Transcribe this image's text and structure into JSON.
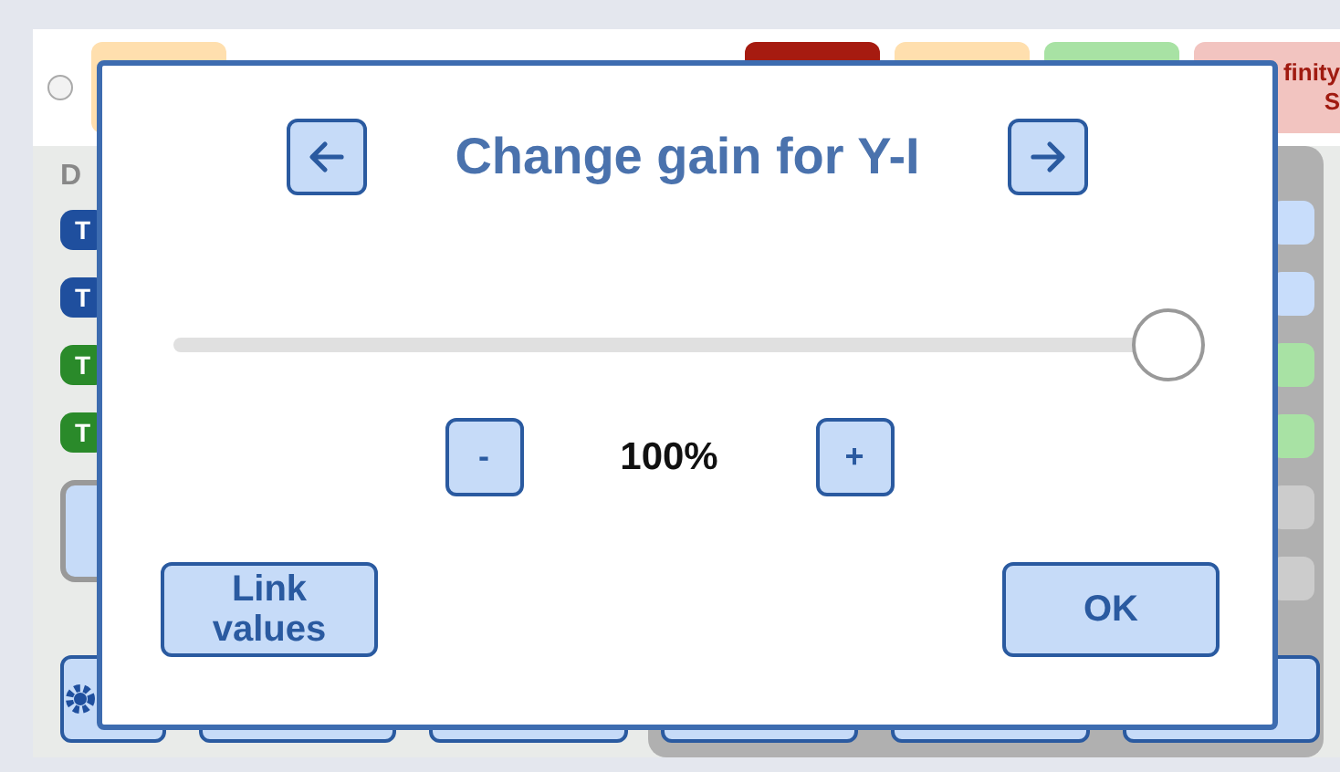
{
  "status_indicator": {
    "on": false
  },
  "top_badges": [
    {
      "color": "#ffdfae"
    },
    {
      "color": "#a61b10"
    },
    {
      "color": "#ffdfae"
    },
    {
      "color": "#a8e2a4"
    },
    {
      "color": "#f2c4c0",
      "lines": [
        "finity",
        "S"
      ]
    }
  ],
  "section_label": "D",
  "left_channels": [
    {
      "label": "T",
      "color": "#1f4f9e"
    },
    {
      "label": "T",
      "color": "#1f4f9e"
    },
    {
      "label": "T",
      "color": "#2a8a2a"
    },
    {
      "label": "T",
      "color": "#2a8a2a"
    }
  ],
  "right_indicators": [
    {
      "color": "#c8ddfb"
    },
    {
      "color": "#c8ddfb"
    },
    {
      "color": "#a8e2a4"
    },
    {
      "color": "#a8e2a4"
    },
    {
      "color": "#cccccc"
    },
    {
      "color": "#cccccc"
    }
  ],
  "dialog": {
    "title": "Change gain for Y-I",
    "slider": {
      "level": 1
    },
    "decrement": "-",
    "value": "100%",
    "increment": "+",
    "buttons": [
      "Link values",
      "OK"
    ]
  }
}
